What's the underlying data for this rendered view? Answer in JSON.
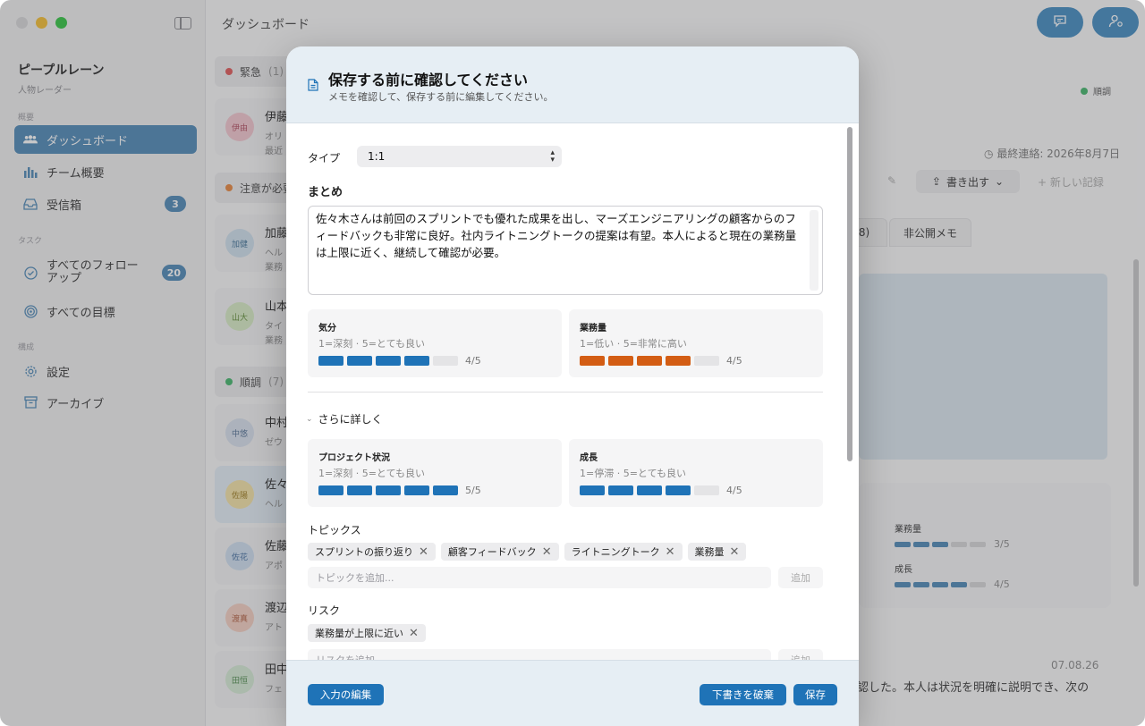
{
  "window": {
    "title": "ダッシュボード"
  },
  "sidebar": {
    "app_name": "ピープルレーン",
    "app_tagline": "人物レーダー",
    "sections": {
      "overview": "概要",
      "tasks": "タスク",
      "config": "構成"
    },
    "items": [
      {
        "label": "ダッシュボード",
        "icon": "people-icon",
        "active": true
      },
      {
        "label": "チーム概要",
        "icon": "bar-chart-icon"
      },
      {
        "label": "受信箱",
        "icon": "inbox-icon",
        "badge": "3"
      },
      {
        "label": "すべてのフォローアップ",
        "icon": "check-circle-icon",
        "badge": "20"
      },
      {
        "label": "すべての目標",
        "icon": "target-icon"
      },
      {
        "label": "設定",
        "icon": "gear-icon"
      },
      {
        "label": "アーカイブ",
        "icon": "archive-icon"
      }
    ]
  },
  "people_list": {
    "groups": [
      {
        "label": "緊急",
        "count": "(1)",
        "color": "#e05555"
      },
      {
        "label": "注意が必要",
        "count": "",
        "color": "#e8833a"
      },
      {
        "label": "順調",
        "count": "(7)",
        "color": "#3fb468"
      }
    ],
    "people": [
      {
        "initials": "伊由",
        "name": "伊藤",
        "sub": "オリ",
        "sub2": "最近",
        "avatar_bg": "#f3c6cf",
        "avatar_fg": "#b0485c"
      },
      {
        "initials": "加健",
        "name": "加藤",
        "sub": "ヘル",
        "sub2": "業務",
        "avatar_bg": "#cfe0ee",
        "avatar_fg": "#3c6f95"
      },
      {
        "initials": "山大",
        "name": "山本",
        "sub": "タイ",
        "sub2": "業務",
        "avatar_bg": "#d8ecc5",
        "avatar_fg": "#5b8a32"
      },
      {
        "initials": "中悠",
        "name": "中村",
        "sub": "ゼウ",
        "sub2": "",
        "avatar_bg": "#d7e1ee",
        "avatar_fg": "#4c6a90"
      },
      {
        "initials": "佐陽",
        "name": "佐々",
        "sub": "ヘル",
        "sub2": "",
        "avatar_bg": "#f5e3a6",
        "avatar_fg": "#9b7a1b"
      },
      {
        "initials": "佐花",
        "name": "佐藤",
        "sub": "アポ",
        "sub2": "",
        "avatar_bg": "#cfdff1",
        "avatar_fg": "#3e6a9d"
      },
      {
        "initials": "渡真",
        "name": "渡辺",
        "sub": "アト",
        "sub2": "",
        "avatar_bg": "#f5cfc2",
        "avatar_fg": "#b05a3b"
      },
      {
        "initials": "田恒",
        "name": "田中",
        "sub": "フェ",
        "sub2": "",
        "avatar_bg": "#d6ecd6",
        "avatar_fg": "#4a8a4a"
      }
    ]
  },
  "detail": {
    "status": "順調",
    "last_contact": "最終連絡: 2026年8月7日",
    "export_label": "書き出す",
    "new_record_label": "新しい記録",
    "tabs": [
      "8)",
      "非公開メモ"
    ],
    "mini_ratings": [
      {
        "label": "業務量",
        "value": "3/5",
        "filled": 3
      },
      {
        "label": "成長",
        "value": "4/5",
        "filled": 4
      }
    ],
    "entry_date": "07.08.26",
    "entry_text": "認した。本人は状況を明確に説明でき、次の"
  },
  "modal": {
    "title": "保存する前に確認してください",
    "subtitle": "メモを確認して、保存する前に編集してください。",
    "type_label": "タイプ",
    "type_value": "1:1",
    "summary_label": "まとめ",
    "summary_text": "佐々木さんは前回のスプリントでも優れた成果を出し、マーズエンジニアリングの顧客からのフィードバックも非常に良好。社内ライトニングトークの提案は有望。本人によると現在の業務量は上限に近く、継続して確認が必要。",
    "ratings": [
      {
        "title": "気分",
        "scale": "1=深刻 · 5=とても良い",
        "value": "4/5",
        "filled": 4,
        "color": "#1f73b7"
      },
      {
        "title": "業務量",
        "scale": "1=低い · 5=非常に高い",
        "value": "4/5",
        "filled": 4,
        "color": "#d35d14"
      }
    ],
    "more_label": "さらに詳しく",
    "more_ratings": [
      {
        "title": "プロジェクト状況",
        "scale": "1=深刻 · 5=とても良い",
        "value": "5/5",
        "filled": 5,
        "color": "#1f73b7"
      },
      {
        "title": "成長",
        "scale": "1=停滞 · 5=とても良い",
        "value": "4/5",
        "filled": 4,
        "color": "#1f73b7"
      }
    ],
    "topics_label": "トピックス",
    "topics": [
      "スプリントの振り返り",
      "顧客フィードバック",
      "ライトニングトーク",
      "業務量"
    ],
    "topic_placeholder": "トピックを追加...",
    "add_label": "追加",
    "risks_label": "リスク",
    "risks": [
      "業務量が上限に近い"
    ],
    "risk_placeholder": "リスクを追加",
    "footer": {
      "edit_input": "入力の編集",
      "discard_draft": "下書きを破棄",
      "save": "保存"
    }
  }
}
